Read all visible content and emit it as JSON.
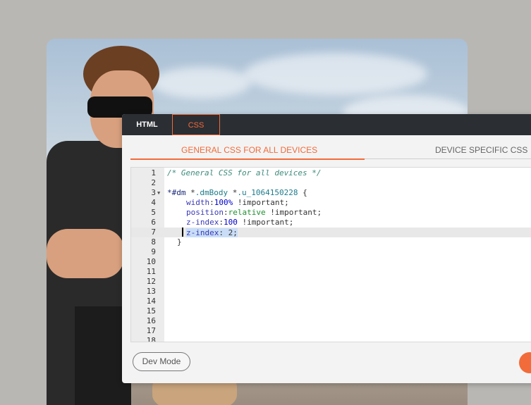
{
  "tabs": {
    "html": "HTML",
    "css": "CSS"
  },
  "subtabs": {
    "general": "GENERAL CSS FOR ALL DEVICES",
    "device": "DEVICE SPECIFIC CSS"
  },
  "editor": {
    "lines": [
      {
        "n": "1"
      },
      {
        "n": "2"
      },
      {
        "n": "3"
      },
      {
        "n": "4"
      },
      {
        "n": "5"
      },
      {
        "n": "6"
      },
      {
        "n": "7"
      },
      {
        "n": "8"
      },
      {
        "n": "9"
      },
      {
        "n": "10"
      },
      {
        "n": "11"
      },
      {
        "n": "12"
      },
      {
        "n": "13"
      },
      {
        "n": "14"
      },
      {
        "n": "15"
      },
      {
        "n": "16"
      },
      {
        "n": "17"
      },
      {
        "n": "18"
      }
    ],
    "code": {
      "l1": "/* General CSS for all devices */",
      "l3_star": "*",
      "l3_id": "#dm",
      "l3_mid": " *",
      "l3_cls1": ".dmBody",
      "l3_mid2": " *",
      "l3_cls2": ".u_1064150228",
      "l3_brace": " {",
      "l4_prop": "width",
      "l4_colon": ":",
      "l4_val": "100%",
      "l4_imp": " !important;",
      "l5_prop": "position",
      "l5_colon": ":",
      "l5_val": "relative",
      "l5_imp": " !important;",
      "l6_prop": "z-index",
      "l6_colon": ":",
      "l6_val": "100",
      "l6_imp": " !important;",
      "l7_prop": "z-index",
      "l7_rest": ": 2;",
      "l8": "}"
    }
  },
  "footer": {
    "dev_mode": "Dev Mode"
  },
  "colors": {
    "accent": "#f26b3a",
    "tabbar": "#2b2e33"
  }
}
